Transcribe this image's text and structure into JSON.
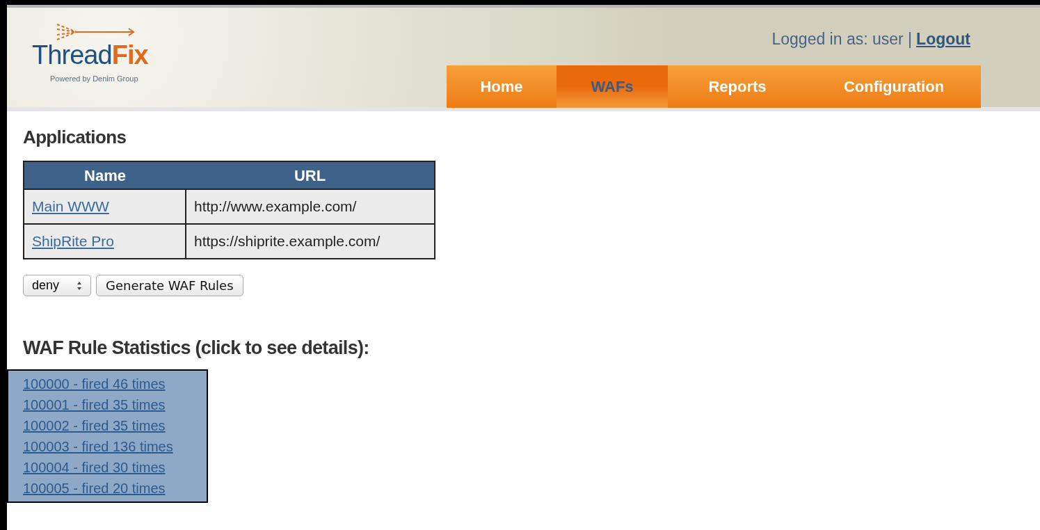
{
  "logo": {
    "name": "Thread",
    "accent": "Fix",
    "tagline": "Powered by Denim Group"
  },
  "login": {
    "text": "Logged in as: user |",
    "link": "Logout"
  },
  "tabs": [
    {
      "label": "Home",
      "selected": false
    },
    {
      "label": "WAFs",
      "selected": true
    },
    {
      "label": "Reports",
      "selected": false
    },
    {
      "label": "Configuration",
      "selected": false
    }
  ],
  "applications": {
    "title": "Applications",
    "columns": [
      "Name",
      "URL"
    ],
    "rows": [
      {
        "name": "Main WWW",
        "url": "http://www.example.com/"
      },
      {
        "name": "ShipRite Pro",
        "url": "https://shiprite.example.com/"
      }
    ]
  },
  "rule_mode": {
    "value": "deny"
  },
  "generate_button": "Generate WAF Rules",
  "statistics": {
    "title": "WAF Rule Statistics (click to see details):",
    "items": [
      "100000 - fired 46 times",
      "100001 - fired 35 times",
      "100002 - fired 35 times",
      "100003 - fired 136 times",
      "100004 - fired 30 times",
      "100005 - fired 20 times"
    ]
  }
}
